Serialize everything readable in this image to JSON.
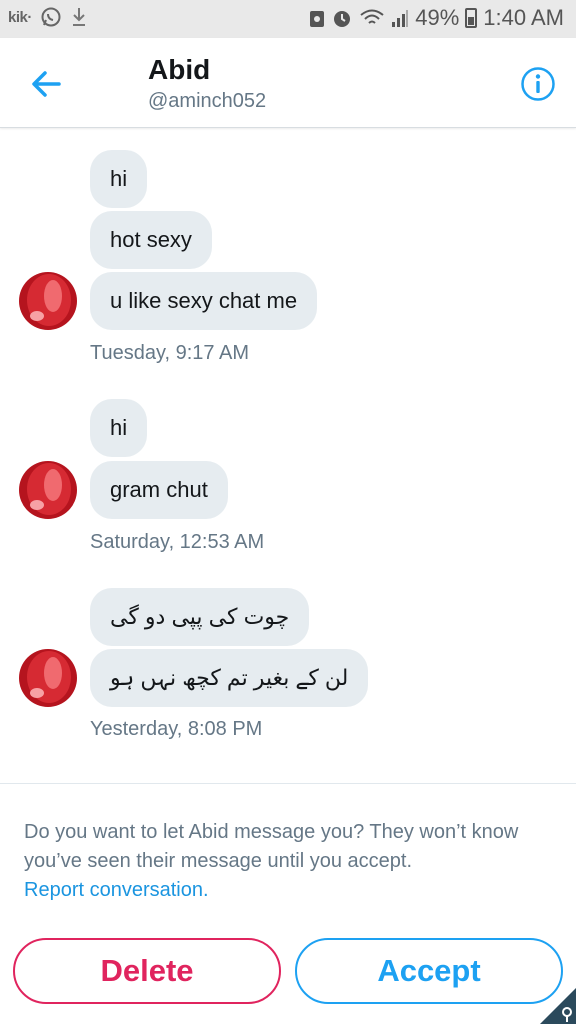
{
  "status_bar": {
    "kik": "kik·",
    "battery_percent": "49%",
    "time": "1:40 AM"
  },
  "header": {
    "name": "Abid",
    "handle": "@aminch052"
  },
  "conversation": [
    {
      "messages": [
        "hi",
        "hot sexy",
        "u like sexy chat me"
      ],
      "timestamp": "Tuesday, 9:17 AM"
    },
    {
      "messages": [
        "hi",
        "gram chut"
      ],
      "timestamp": "Saturday, 12:53 AM"
    },
    {
      "messages": [
        "چوت کی پپی دو گی",
        "لن کے بغیر تم کچھ نہں ہو"
      ],
      "timestamp": "Yesterday, 8:08 PM"
    }
  ],
  "request": {
    "prompt_text": "Do you want to let Abid message you? They won’t know you’ve seen their message until you accept.",
    "report_link": "Report conversation."
  },
  "actions": {
    "delete_label": "Delete",
    "accept_label": "Accept"
  },
  "colors": {
    "accent_blue": "#1da1f2",
    "delete_red": "#e0245e",
    "bubble_gray": "#e6ecf0",
    "secondary_text": "#657786"
  }
}
